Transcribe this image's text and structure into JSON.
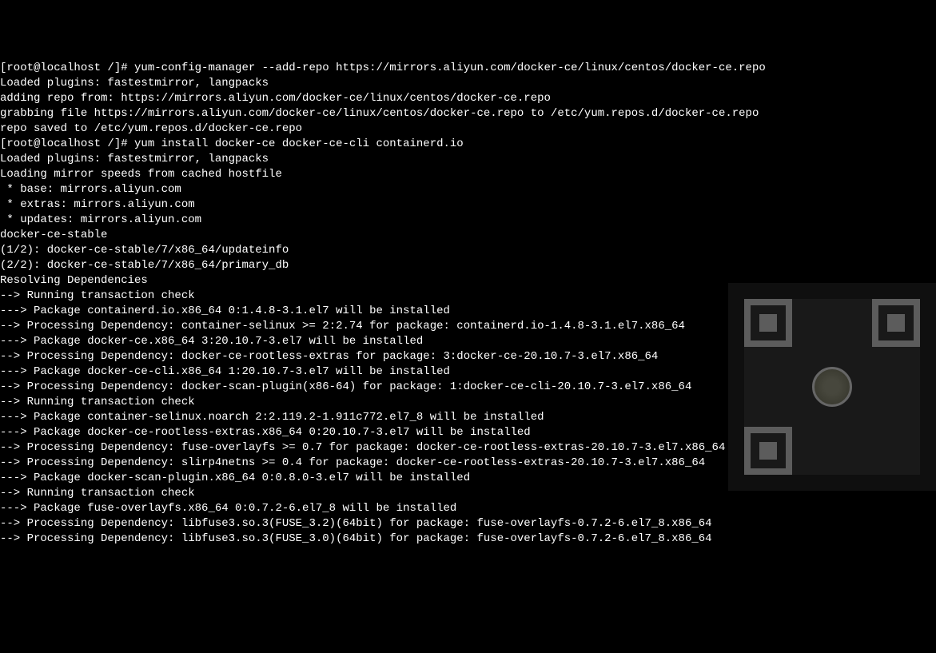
{
  "terminal": {
    "lines": [
      "[root@localhost /]# yum-config-manager --add-repo https://mirrors.aliyun.com/docker-ce/linux/centos/docker-ce.repo",
      "Loaded plugins: fastestmirror, langpacks",
      "adding repo from: https://mirrors.aliyun.com/docker-ce/linux/centos/docker-ce.repo",
      "grabbing file https://mirrors.aliyun.com/docker-ce/linux/centos/docker-ce.repo to /etc/yum.repos.d/docker-ce.repo",
      "repo saved to /etc/yum.repos.d/docker-ce.repo",
      "[root@localhost /]# yum install docker-ce docker-ce-cli containerd.io",
      "Loaded plugins: fastestmirror, langpacks",
      "Loading mirror speeds from cached hostfile",
      " * base: mirrors.aliyun.com",
      " * extras: mirrors.aliyun.com",
      " * updates: mirrors.aliyun.com",
      "docker-ce-stable",
      "(1/2): docker-ce-stable/7/x86_64/updateinfo",
      "(2/2): docker-ce-stable/7/x86_64/primary_db",
      "Resolving Dependencies",
      "--> Running transaction check",
      "---> Package containerd.io.x86_64 0:1.4.8-3.1.el7 will be installed",
      "--> Processing Dependency: container-selinux >= 2:2.74 for package: containerd.io-1.4.8-3.1.el7.x86_64",
      "---> Package docker-ce.x86_64 3:20.10.7-3.el7 will be installed",
      "--> Processing Dependency: docker-ce-rootless-extras for package: 3:docker-ce-20.10.7-3.el7.x86_64",
      "---> Package docker-ce-cli.x86_64 1:20.10.7-3.el7 will be installed",
      "--> Processing Dependency: docker-scan-plugin(x86-64) for package: 1:docker-ce-cli-20.10.7-3.el7.x86_64",
      "--> Running transaction check",
      "---> Package container-selinux.noarch 2:2.119.2-1.911c772.el7_8 will be installed",
      "---> Package docker-ce-rootless-extras.x86_64 0:20.10.7-3.el7 will be installed",
      "--> Processing Dependency: fuse-overlayfs >= 0.7 for package: docker-ce-rootless-extras-20.10.7-3.el7.x86_64",
      "--> Processing Dependency: slirp4netns >= 0.4 for package: docker-ce-rootless-extras-20.10.7-3.el7.x86_64",
      "---> Package docker-scan-plugin.x86_64 0:0.8.0-3.el7 will be installed",
      "--> Running transaction check",
      "---> Package fuse-overlayfs.x86_64 0:0.7.2-6.el7_8 will be installed",
      "--> Processing Dependency: libfuse3.so.3(FUSE_3.2)(64bit) for package: fuse-overlayfs-0.7.2-6.el7_8.x86_64",
      "--> Processing Dependency: libfuse3.so.3(FUSE_3.0)(64bit) for package: fuse-overlayfs-0.7.2-6.el7_8.x86_64"
    ]
  },
  "watermark": {
    "type": "qr-code"
  }
}
